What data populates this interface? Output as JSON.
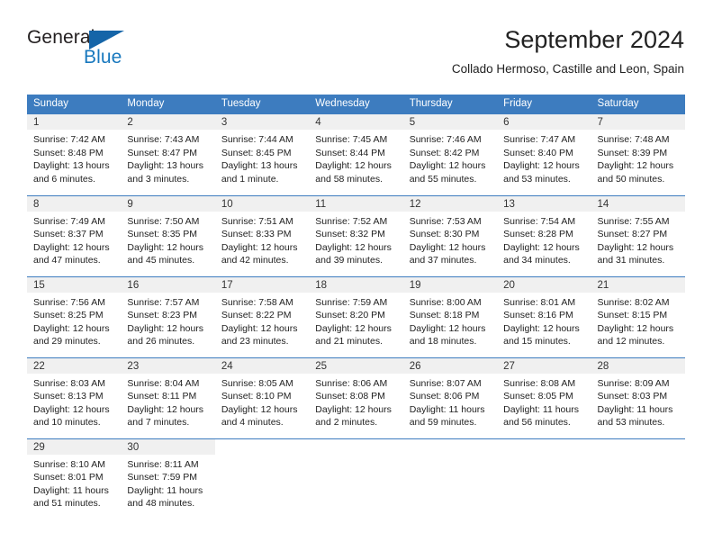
{
  "brand": {
    "name_part1": "General",
    "name_part2": "Blue",
    "accent_color": "#1878be",
    "flag_color": "#1565a8"
  },
  "header": {
    "title": "September 2024",
    "subtitle": "Collado Hermoso, Castille and Leon, Spain"
  },
  "colors": {
    "header_blue": "#3d7cbf",
    "daynum_band": "#f0f0f0",
    "text": "#222222"
  },
  "weekday_headers": [
    "Sunday",
    "Monday",
    "Tuesday",
    "Wednesday",
    "Thursday",
    "Friday",
    "Saturday"
  ],
  "weeks": [
    [
      {
        "day": "1",
        "sunrise": "Sunrise: 7:42 AM",
        "sunset": "Sunset: 8:48 PM",
        "daylight1": "Daylight: 13 hours",
        "daylight2": "and 6 minutes."
      },
      {
        "day": "2",
        "sunrise": "Sunrise: 7:43 AM",
        "sunset": "Sunset: 8:47 PM",
        "daylight1": "Daylight: 13 hours",
        "daylight2": "and 3 minutes."
      },
      {
        "day": "3",
        "sunrise": "Sunrise: 7:44 AM",
        "sunset": "Sunset: 8:45 PM",
        "daylight1": "Daylight: 13 hours",
        "daylight2": "and 1 minute."
      },
      {
        "day": "4",
        "sunrise": "Sunrise: 7:45 AM",
        "sunset": "Sunset: 8:44 PM",
        "daylight1": "Daylight: 12 hours",
        "daylight2": "and 58 minutes."
      },
      {
        "day": "5",
        "sunrise": "Sunrise: 7:46 AM",
        "sunset": "Sunset: 8:42 PM",
        "daylight1": "Daylight: 12 hours",
        "daylight2": "and 55 minutes."
      },
      {
        "day": "6",
        "sunrise": "Sunrise: 7:47 AM",
        "sunset": "Sunset: 8:40 PM",
        "daylight1": "Daylight: 12 hours",
        "daylight2": "and 53 minutes."
      },
      {
        "day": "7",
        "sunrise": "Sunrise: 7:48 AM",
        "sunset": "Sunset: 8:39 PM",
        "daylight1": "Daylight: 12 hours",
        "daylight2": "and 50 minutes."
      }
    ],
    [
      {
        "day": "8",
        "sunrise": "Sunrise: 7:49 AM",
        "sunset": "Sunset: 8:37 PM",
        "daylight1": "Daylight: 12 hours",
        "daylight2": "and 47 minutes."
      },
      {
        "day": "9",
        "sunrise": "Sunrise: 7:50 AM",
        "sunset": "Sunset: 8:35 PM",
        "daylight1": "Daylight: 12 hours",
        "daylight2": "and 45 minutes."
      },
      {
        "day": "10",
        "sunrise": "Sunrise: 7:51 AM",
        "sunset": "Sunset: 8:33 PM",
        "daylight1": "Daylight: 12 hours",
        "daylight2": "and 42 minutes."
      },
      {
        "day": "11",
        "sunrise": "Sunrise: 7:52 AM",
        "sunset": "Sunset: 8:32 PM",
        "daylight1": "Daylight: 12 hours",
        "daylight2": "and 39 minutes."
      },
      {
        "day": "12",
        "sunrise": "Sunrise: 7:53 AM",
        "sunset": "Sunset: 8:30 PM",
        "daylight1": "Daylight: 12 hours",
        "daylight2": "and 37 minutes."
      },
      {
        "day": "13",
        "sunrise": "Sunrise: 7:54 AM",
        "sunset": "Sunset: 8:28 PM",
        "daylight1": "Daylight: 12 hours",
        "daylight2": "and 34 minutes."
      },
      {
        "day": "14",
        "sunrise": "Sunrise: 7:55 AM",
        "sunset": "Sunset: 8:27 PM",
        "daylight1": "Daylight: 12 hours",
        "daylight2": "and 31 minutes."
      }
    ],
    [
      {
        "day": "15",
        "sunrise": "Sunrise: 7:56 AM",
        "sunset": "Sunset: 8:25 PM",
        "daylight1": "Daylight: 12 hours",
        "daylight2": "and 29 minutes."
      },
      {
        "day": "16",
        "sunrise": "Sunrise: 7:57 AM",
        "sunset": "Sunset: 8:23 PM",
        "daylight1": "Daylight: 12 hours",
        "daylight2": "and 26 minutes."
      },
      {
        "day": "17",
        "sunrise": "Sunrise: 7:58 AM",
        "sunset": "Sunset: 8:22 PM",
        "daylight1": "Daylight: 12 hours",
        "daylight2": "and 23 minutes."
      },
      {
        "day": "18",
        "sunrise": "Sunrise: 7:59 AM",
        "sunset": "Sunset: 8:20 PM",
        "daylight1": "Daylight: 12 hours",
        "daylight2": "and 21 minutes."
      },
      {
        "day": "19",
        "sunrise": "Sunrise: 8:00 AM",
        "sunset": "Sunset: 8:18 PM",
        "daylight1": "Daylight: 12 hours",
        "daylight2": "and 18 minutes."
      },
      {
        "day": "20",
        "sunrise": "Sunrise: 8:01 AM",
        "sunset": "Sunset: 8:16 PM",
        "daylight1": "Daylight: 12 hours",
        "daylight2": "and 15 minutes."
      },
      {
        "day": "21",
        "sunrise": "Sunrise: 8:02 AM",
        "sunset": "Sunset: 8:15 PM",
        "daylight1": "Daylight: 12 hours",
        "daylight2": "and 12 minutes."
      }
    ],
    [
      {
        "day": "22",
        "sunrise": "Sunrise: 8:03 AM",
        "sunset": "Sunset: 8:13 PM",
        "daylight1": "Daylight: 12 hours",
        "daylight2": "and 10 minutes."
      },
      {
        "day": "23",
        "sunrise": "Sunrise: 8:04 AM",
        "sunset": "Sunset: 8:11 PM",
        "daylight1": "Daylight: 12 hours",
        "daylight2": "and 7 minutes."
      },
      {
        "day": "24",
        "sunrise": "Sunrise: 8:05 AM",
        "sunset": "Sunset: 8:10 PM",
        "daylight1": "Daylight: 12 hours",
        "daylight2": "and 4 minutes."
      },
      {
        "day": "25",
        "sunrise": "Sunrise: 8:06 AM",
        "sunset": "Sunset: 8:08 PM",
        "daylight1": "Daylight: 12 hours",
        "daylight2": "and 2 minutes."
      },
      {
        "day": "26",
        "sunrise": "Sunrise: 8:07 AM",
        "sunset": "Sunset: 8:06 PM",
        "daylight1": "Daylight: 11 hours",
        "daylight2": "and 59 minutes."
      },
      {
        "day": "27",
        "sunrise": "Sunrise: 8:08 AM",
        "sunset": "Sunset: 8:05 PM",
        "daylight1": "Daylight: 11 hours",
        "daylight2": "and 56 minutes."
      },
      {
        "day": "28",
        "sunrise": "Sunrise: 8:09 AM",
        "sunset": "Sunset: 8:03 PM",
        "daylight1": "Daylight: 11 hours",
        "daylight2": "and 53 minutes."
      }
    ],
    [
      {
        "day": "29",
        "sunrise": "Sunrise: 8:10 AM",
        "sunset": "Sunset: 8:01 PM",
        "daylight1": "Daylight: 11 hours",
        "daylight2": "and 51 minutes."
      },
      {
        "day": "30",
        "sunrise": "Sunrise: 8:11 AM",
        "sunset": "Sunset: 7:59 PM",
        "daylight1": "Daylight: 11 hours",
        "daylight2": "and 48 minutes."
      },
      {
        "day": "",
        "sunrise": "",
        "sunset": "",
        "daylight1": "",
        "daylight2": ""
      },
      {
        "day": "",
        "sunrise": "",
        "sunset": "",
        "daylight1": "",
        "daylight2": ""
      },
      {
        "day": "",
        "sunrise": "",
        "sunset": "",
        "daylight1": "",
        "daylight2": ""
      },
      {
        "day": "",
        "sunrise": "",
        "sunset": "",
        "daylight1": "",
        "daylight2": ""
      },
      {
        "day": "",
        "sunrise": "",
        "sunset": "",
        "daylight1": "",
        "daylight2": ""
      }
    ]
  ]
}
